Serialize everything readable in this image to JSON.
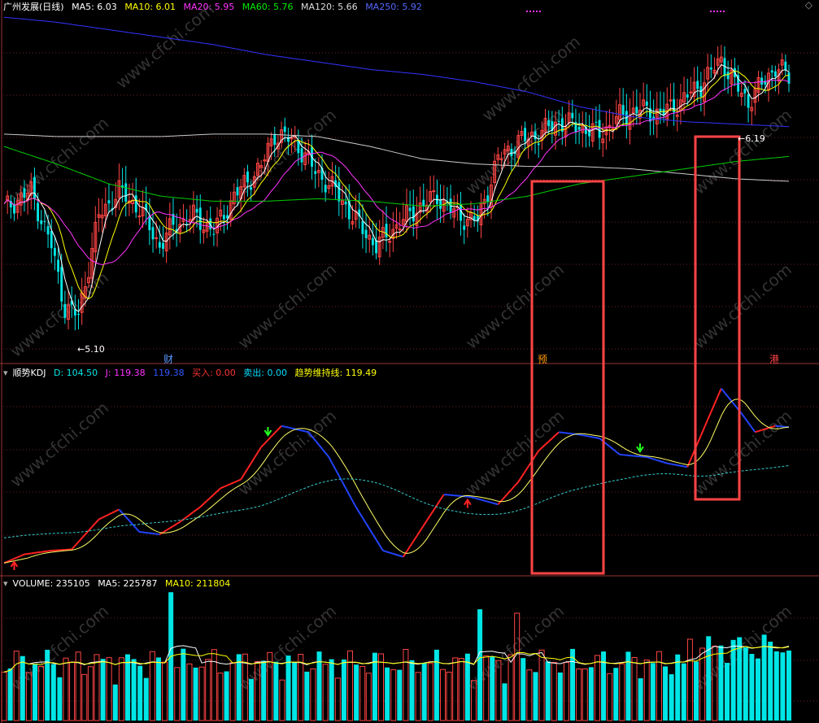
{
  "header": {
    "title": "广州发展(日线)",
    "ma5": "MA5: 6.03",
    "ma10": "MA10: 6.01",
    "ma20": "MA20: 5.95",
    "ma60": "MA60: 5.76",
    "ma120": "MA120: 5.66",
    "ma250": "MA250: 5.92"
  },
  "kdj_header": {
    "title": "顺势KDJ",
    "d": "D: 104.50",
    "j": "J: 119.38",
    "k": "119.38",
    "buy": "买入: 0.00",
    "sell": "卖出: 0.00",
    "trend": "趋势维持线: 119.49"
  },
  "vol_header": {
    "volume": "VOLUME: 235105",
    "ma5": "MA5: 225787",
    "ma10": "MA10: 211804"
  },
  "annotations": {
    "low": "5.10",
    "high": "6.19",
    "marker_cai": "财",
    "marker_yu": "预",
    "marker_gang": "港"
  },
  "watermark": "www.cfchi.com",
  "colors": {
    "up": "#ff4444",
    "down": "#00e5e5",
    "ma5": "#ffffff",
    "ma10": "#ffff00",
    "ma20": "#ff33ff",
    "ma60": "#00cc00",
    "ma120": "#cccccc",
    "ma250": "#3333ff",
    "highlight_box": "#ff4444"
  },
  "chart_data": [
    {
      "type": "candlestick",
      "title": "广州发展(日线)",
      "ylim": [
        4.95,
        6.35
      ],
      "annotations": [
        {
          "label": "5.10",
          "value": 5.1
        },
        {
          "label": "6.19",
          "value": 6.19
        }
      ],
      "series": [
        {
          "name": "MA250",
          "values": [
            6.32,
            6.3,
            6.27,
            6.24,
            6.21,
            6.17,
            6.14,
            6.11,
            6.09,
            6.06,
            6.02,
            5.96,
            5.92,
            5.9,
            5.89,
            5.88
          ]
        },
        {
          "name": "MA120",
          "values": [
            5.85,
            5.84,
            5.84,
            5.84,
            5.85,
            5.85,
            5.84,
            5.8,
            5.75,
            5.73,
            5.72,
            5.72,
            5.71,
            5.69,
            5.67,
            5.66
          ]
        },
        {
          "name": "MA60",
          "values": [
            5.8,
            5.73,
            5.65,
            5.6,
            5.58,
            5.58,
            5.59,
            5.58,
            5.56,
            5.57,
            5.6,
            5.65,
            5.68,
            5.71,
            5.74,
            5.76
          ]
        }
      ]
    },
    {
      "type": "line",
      "title": "顺势KDJ",
      "series": [
        {
          "name": "D",
          "last": 104.5
        },
        {
          "name": "J",
          "last": 119.38
        },
        {
          "name": "买入",
          "last": 0.0
        },
        {
          "name": "卖出",
          "last": 0.0
        },
        {
          "name": "趋势维持线",
          "last": 119.49
        }
      ]
    },
    {
      "type": "bar",
      "title": "VOLUME",
      "series": [
        {
          "name": "VOLUME",
          "last": 235105
        },
        {
          "name": "MA5",
          "last": 225787
        },
        {
          "name": "MA10",
          "last": 211804
        }
      ]
    }
  ]
}
